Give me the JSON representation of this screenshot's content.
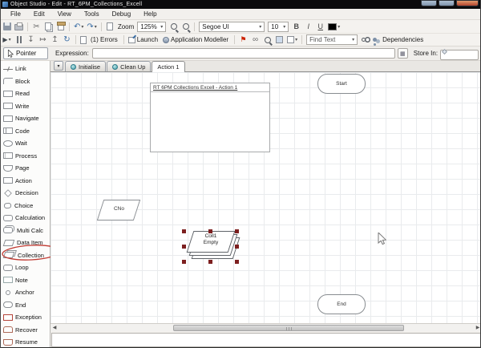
{
  "window": {
    "title": "Object Studio  - Edit - RT_6PM_Collections_Excell"
  },
  "menu": {
    "items": [
      "File",
      "Edit",
      "View",
      "Tools",
      "Debug",
      "Help"
    ]
  },
  "toolbar": {
    "zoom_label": "Zoom",
    "zoom_value": "125%",
    "font_name": "Segoe UI",
    "font_size": "10",
    "bold_label": "B",
    "italic_label": "I",
    "underline_label": "U",
    "errors_label": "(1) Errors",
    "launch_label": "Launch",
    "app_modeller_label": "Application Modeller",
    "find_text_value": "Find Text",
    "dependencies_label": "Dependencies"
  },
  "expression_row": {
    "pointer_label": "Pointer",
    "expression_label": "Expression:",
    "expression_value": "",
    "store_in_label": "Store In:",
    "store_in_value": ""
  },
  "tabs": {
    "items": [
      {
        "label": "Initialise",
        "icon": "page-gear-icon",
        "active": false
      },
      {
        "label": "Clean Up",
        "icon": "page-gear-icon",
        "active": false
      },
      {
        "label": "Action 1",
        "icon": null,
        "active": true
      }
    ]
  },
  "sidebar": {
    "tools": [
      {
        "label": "Link",
        "icon": "link-icon"
      },
      {
        "label": "Block",
        "icon": "block-icon"
      },
      {
        "label": "Read",
        "icon": "read-icon"
      },
      {
        "label": "Write",
        "icon": "write-icon"
      },
      {
        "label": "Navigate",
        "icon": "navigate-icon"
      },
      {
        "label": "Code",
        "icon": "code-icon"
      },
      {
        "label": "Wait",
        "icon": "wait-icon"
      },
      {
        "label": "Process",
        "icon": "process-icon"
      },
      {
        "label": "Page",
        "icon": "page-icon-s"
      },
      {
        "label": "Action",
        "icon": "action-icon"
      },
      {
        "label": "Decision",
        "icon": "decision-icon"
      },
      {
        "label": "Choice",
        "icon": "choice-icon"
      },
      {
        "label": "Calculation",
        "icon": "calculation-icon"
      },
      {
        "label": "Multi Calc",
        "icon": "multicalc-icon"
      },
      {
        "label": "Data Item",
        "icon": "dataitem-icon"
      },
      {
        "label": "Collection",
        "icon": "collection-icon",
        "annotated": true
      },
      {
        "label": "Loop",
        "icon": "loop-icon"
      },
      {
        "label": "Note",
        "icon": "note-icon"
      },
      {
        "label": "Anchor",
        "icon": "anchor-icon"
      },
      {
        "label": "End",
        "icon": "end-icon"
      },
      {
        "label": "Exception",
        "icon": "exception-icon"
      },
      {
        "label": "Recover",
        "icon": "recover-icon"
      },
      {
        "label": "Resume",
        "icon": "resume-icon"
      }
    ]
  },
  "canvas": {
    "page_header": "RT 6PM Collections Excell - Action 1",
    "nodes": {
      "start": {
        "label": "Start"
      },
      "cno": {
        "label": "CNo"
      },
      "collection": {
        "name": "Coll1",
        "status": "Empty"
      },
      "end": {
        "label": "End"
      }
    }
  },
  "colors": {
    "selection_handle": "#7d2020",
    "annotation_red": "#c03a32",
    "accent_blue": "#3b6ea5",
    "flag_red": "#cc2200",
    "titlebar": "#0b0b0d"
  }
}
